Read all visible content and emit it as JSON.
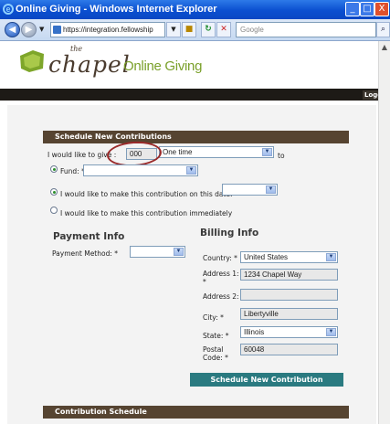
{
  "window": {
    "title": "Online Giving - Windows Internet Explorer",
    "minimize": "_",
    "maximize": "□",
    "close": "X"
  },
  "browser": {
    "url": "https://integration.fellowship",
    "search_placeholder": "Google",
    "back": "◀",
    "forward": "▶",
    "drop": "▼",
    "search_go": "⌕"
  },
  "brand": {
    "the": "the",
    "chapel": "chapel",
    "site_title": "Online Giving",
    "logout": "Logo"
  },
  "schedule": {
    "header": "Schedule New Contributions",
    "give_label": "I would like to give :",
    "amount": "000",
    "frequency": "One time",
    "to_label": "to",
    "fund_label": "Fund: *",
    "fund_value": "",
    "date_option": "I would like to make this contribution on this date: *",
    "date_value": "",
    "immediate_option": "I would like to make this contribution immediately"
  },
  "payment": {
    "heading": "Payment Info",
    "method_label": "Payment Method: *",
    "method_value": ""
  },
  "billing": {
    "heading": "Billing Info",
    "country_label": "Country: *",
    "country_value": "United States",
    "address1_label": "Address 1: *",
    "address1_value": "1234 Chapel Way",
    "address2_label": "Address 2:",
    "address2_value": "",
    "city_label": "City: *",
    "city_value": "Libertyville",
    "state_label": "State: *",
    "state_value": "Illinois",
    "postal_label": "Postal Code: *",
    "postal_value": "60048"
  },
  "actions": {
    "submit": "Schedule New Contribution"
  },
  "contribution_schedule": {
    "header": "Contribution Schedule"
  }
}
